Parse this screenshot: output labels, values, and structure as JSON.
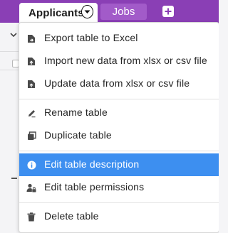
{
  "tabs": {
    "active": {
      "label": "Applicants"
    },
    "other": [
      {
        "label": "Jobs"
      }
    ],
    "add_icon": "plus-icon"
  },
  "menu": {
    "items": [
      {
        "id": "export",
        "label": "Export table to Excel",
        "icon": "file-export-icon"
      },
      {
        "id": "import",
        "label": "Import new data from xlsx or csv file",
        "icon": "file-import-icon"
      },
      {
        "id": "update",
        "label": "Update data from xlsx or csv file",
        "icon": "file-import-icon"
      },
      {
        "id": "rename",
        "label": "Rename table",
        "icon": "pencil-icon"
      },
      {
        "id": "duplicate",
        "label": "Duplicate table",
        "icon": "duplicate-icon"
      },
      {
        "id": "edit-description",
        "label": "Edit table description",
        "icon": "info-icon",
        "highlighted": true
      },
      {
        "id": "edit-permissions",
        "label": "Edit table permissions",
        "icon": "user-lock-icon"
      },
      {
        "id": "delete",
        "label": "Delete table",
        "icon": "trash-icon"
      }
    ]
  },
  "colors": {
    "tabbar_bg": "#8a3fb5",
    "highlight": "#3d8ff0"
  }
}
